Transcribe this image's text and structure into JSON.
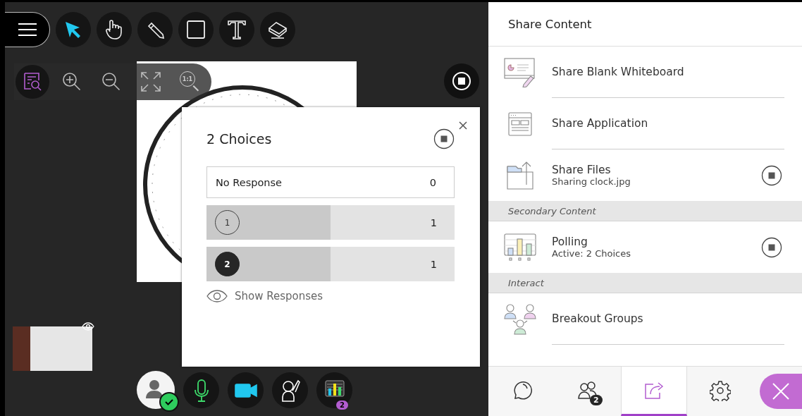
{
  "tools": [
    {
      "kind": "menu",
      "selected": false
    },
    {
      "kind": "pointer",
      "selected": true
    },
    {
      "kind": "hand",
      "selected": false
    },
    {
      "kind": "pencil",
      "selected": false
    },
    {
      "kind": "rectangle",
      "selected": false
    },
    {
      "kind": "text",
      "selected": false
    },
    {
      "kind": "eraser",
      "selected": false
    }
  ],
  "zoom_tools": [
    {
      "kind": "inspect",
      "selected": true
    },
    {
      "kind": "zoom_in",
      "selected": false
    },
    {
      "kind": "zoom_out",
      "selected": false
    },
    {
      "kind": "fit",
      "selected": false
    },
    {
      "kind": "actual_size",
      "label": "1:1",
      "selected": false
    }
  ],
  "poll": {
    "title": "2 Choices",
    "rows": [
      {
        "kind": "none",
        "label": "No Response",
        "count": "0"
      },
      {
        "kind": "choice",
        "label": "1",
        "count": "1",
        "level": 0.5,
        "selected": false
      },
      {
        "kind": "choice",
        "label": "2",
        "count": "1",
        "level": 0.5,
        "selected": true
      }
    ],
    "show_responses": "Show Responses"
  },
  "media": [
    {
      "kind": "avatar",
      "on": true
    },
    {
      "kind": "mic",
      "on": true
    },
    {
      "kind": "camera",
      "on": true
    },
    {
      "kind": "hand",
      "on": false
    },
    {
      "kind": "polls",
      "badge": "2"
    }
  ],
  "panel": {
    "title": "Share Content",
    "sections": [
      {
        "items": [
          {
            "kind": "whiteboard",
            "label": "Share Blank Whiteboard",
            "active": false
          },
          {
            "kind": "application",
            "label": "Share Application",
            "active": false
          },
          {
            "kind": "files",
            "label": "Share Files",
            "sublabel": "Sharing clock.jpg",
            "active": true
          }
        ]
      },
      {
        "heading": "Secondary Content",
        "items": [
          {
            "kind": "polling",
            "label": "Polling",
            "sublabel": "Active: 2 Choices",
            "active": true
          }
        ]
      },
      {
        "heading": "Interact",
        "items": [
          {
            "kind": "breakout",
            "label": "Breakout Groups",
            "active": false
          }
        ]
      }
    ]
  },
  "tabs": [
    {
      "kind": "chat",
      "selected": false
    },
    {
      "kind": "attendees",
      "badge": "2",
      "selected": false
    },
    {
      "kind": "share",
      "selected": true
    },
    {
      "kind": "settings",
      "selected": false
    }
  ]
}
